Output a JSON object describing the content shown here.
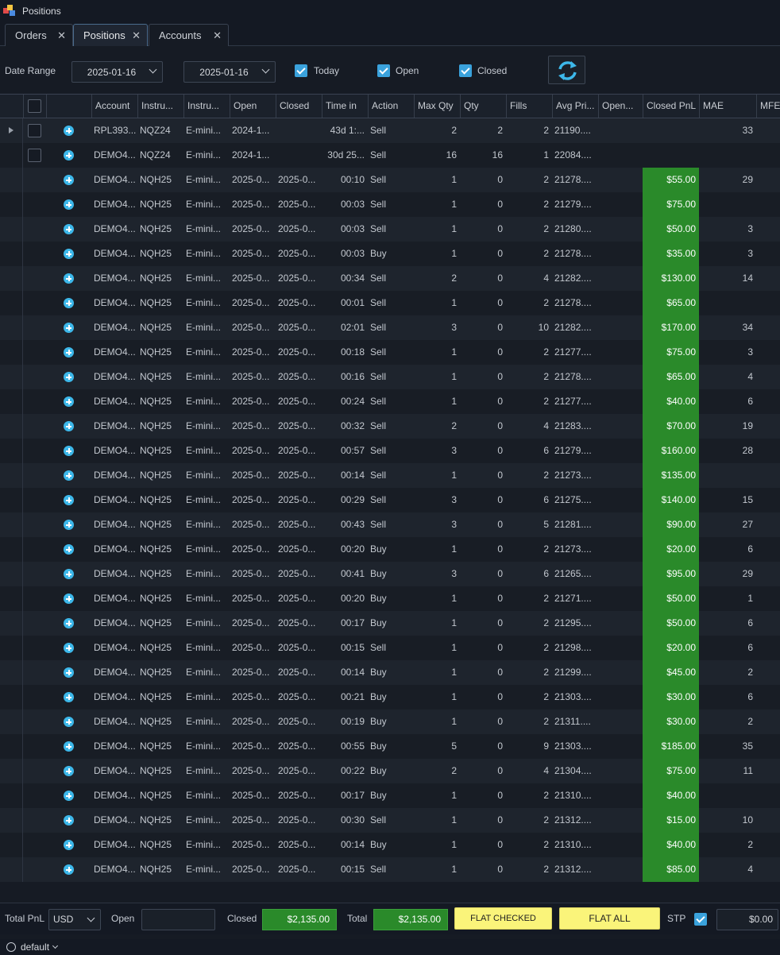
{
  "window": {
    "title": "Positions"
  },
  "tabs": [
    {
      "label": "Orders"
    },
    {
      "label": "Positions"
    },
    {
      "label": "Accounts"
    }
  ],
  "toolbar": {
    "date_range_label": "Date Range",
    "date_from": "2025-01-16",
    "date_to": "2025-01-16",
    "today_label": "Today",
    "open_label": "Open",
    "closed_label": "Closed"
  },
  "columns": [
    "Account",
    "Instru...",
    "Instru...",
    "Open",
    "Closed",
    "Time in",
    "Action",
    "Max Qty",
    "Qty",
    "Fills",
    "Avg Pri...",
    "Open...",
    "Closed PnL",
    "MAE",
    "MFE"
  ],
  "rows": [
    {
      "account": "RPL393...",
      "inst": "NQZ24",
      "desc": "E-mini...",
      "open": "2024-1...",
      "closed": "",
      "time": "43d 1:...",
      "action": "Sell",
      "maxqty": "2",
      "qty": "2",
      "fills": "2",
      "avg": "21190....",
      "openpnl": "",
      "pnl": "",
      "mae": "33",
      "mfe": ""
    },
    {
      "account": "DEMO4...",
      "inst": "NQZ24",
      "desc": "E-mini...",
      "open": "2024-1...",
      "closed": "",
      "time": "30d 25...",
      "action": "Sell",
      "maxqty": "16",
      "qty": "16",
      "fills": "1",
      "avg": "22084....",
      "openpnl": "",
      "pnl": "",
      "mae": "",
      "mfe": ""
    },
    {
      "account": "DEMO4...",
      "inst": "NQH25",
      "desc": "E-mini...",
      "open": "2025-0...",
      "closed": "2025-0...",
      "time": "00:10",
      "action": "Sell",
      "maxqty": "1",
      "qty": "0",
      "fills": "2",
      "avg": "21278....",
      "openpnl": "",
      "pnl": "$55.00",
      "mae": "29",
      "mfe": ""
    },
    {
      "account": "DEMO4...",
      "inst": "NQH25",
      "desc": "E-mini...",
      "open": "2025-0...",
      "closed": "2025-0...",
      "time": "00:03",
      "action": "Sell",
      "maxqty": "1",
      "qty": "0",
      "fills": "2",
      "avg": "21279....",
      "openpnl": "",
      "pnl": "$75.00",
      "mae": "",
      "mfe": ""
    },
    {
      "account": "DEMO4...",
      "inst": "NQH25",
      "desc": "E-mini...",
      "open": "2025-0...",
      "closed": "2025-0...",
      "time": "00:03",
      "action": "Sell",
      "maxqty": "1",
      "qty": "0",
      "fills": "2",
      "avg": "21280....",
      "openpnl": "",
      "pnl": "$50.00",
      "mae": "3",
      "mfe": ""
    },
    {
      "account": "DEMO4...",
      "inst": "NQH25",
      "desc": "E-mini...",
      "open": "2025-0...",
      "closed": "2025-0...",
      "time": "00:03",
      "action": "Buy",
      "maxqty": "1",
      "qty": "0",
      "fills": "2",
      "avg": "21278....",
      "openpnl": "",
      "pnl": "$35.00",
      "mae": "3",
      "mfe": ""
    },
    {
      "account": "DEMO4...",
      "inst": "NQH25",
      "desc": "E-mini...",
      "open": "2025-0...",
      "closed": "2025-0...",
      "time": "00:34",
      "action": "Sell",
      "maxqty": "2",
      "qty": "0",
      "fills": "4",
      "avg": "21282....",
      "openpnl": "",
      "pnl": "$130.00",
      "mae": "14",
      "mfe": ""
    },
    {
      "account": "DEMO4...",
      "inst": "NQH25",
      "desc": "E-mini...",
      "open": "2025-0...",
      "closed": "2025-0...",
      "time": "00:01",
      "action": "Sell",
      "maxqty": "1",
      "qty": "0",
      "fills": "2",
      "avg": "21278....",
      "openpnl": "",
      "pnl": "$65.00",
      "mae": "",
      "mfe": ""
    },
    {
      "account": "DEMO4...",
      "inst": "NQH25",
      "desc": "E-mini...",
      "open": "2025-0...",
      "closed": "2025-0...",
      "time": "02:01",
      "action": "Sell",
      "maxqty": "3",
      "qty": "0",
      "fills": "10",
      "avg": "21282....",
      "openpnl": "",
      "pnl": "$170.00",
      "mae": "34",
      "mfe": ""
    },
    {
      "account": "DEMO4...",
      "inst": "NQH25",
      "desc": "E-mini...",
      "open": "2025-0...",
      "closed": "2025-0...",
      "time": "00:18",
      "action": "Sell",
      "maxqty": "1",
      "qty": "0",
      "fills": "2",
      "avg": "21277....",
      "openpnl": "",
      "pnl": "$75.00",
      "mae": "3",
      "mfe": ""
    },
    {
      "account": "DEMO4...",
      "inst": "NQH25",
      "desc": "E-mini...",
      "open": "2025-0...",
      "closed": "2025-0...",
      "time": "00:16",
      "action": "Sell",
      "maxqty": "1",
      "qty": "0",
      "fills": "2",
      "avg": "21278....",
      "openpnl": "",
      "pnl": "$65.00",
      "mae": "4",
      "mfe": ""
    },
    {
      "account": "DEMO4...",
      "inst": "NQH25",
      "desc": "E-mini...",
      "open": "2025-0...",
      "closed": "2025-0...",
      "time": "00:24",
      "action": "Sell",
      "maxqty": "1",
      "qty": "0",
      "fills": "2",
      "avg": "21277....",
      "openpnl": "",
      "pnl": "$40.00",
      "mae": "6",
      "mfe": ""
    },
    {
      "account": "DEMO4...",
      "inst": "NQH25",
      "desc": "E-mini...",
      "open": "2025-0...",
      "closed": "2025-0...",
      "time": "00:32",
      "action": "Sell",
      "maxqty": "2",
      "qty": "0",
      "fills": "4",
      "avg": "21283....",
      "openpnl": "",
      "pnl": "$70.00",
      "mae": "19",
      "mfe": ""
    },
    {
      "account": "DEMO4...",
      "inst": "NQH25",
      "desc": "E-mini...",
      "open": "2025-0...",
      "closed": "2025-0...",
      "time": "00:57",
      "action": "Sell",
      "maxqty": "3",
      "qty": "0",
      "fills": "6",
      "avg": "21279....",
      "openpnl": "",
      "pnl": "$160.00",
      "mae": "28",
      "mfe": ""
    },
    {
      "account": "DEMO4...",
      "inst": "NQH25",
      "desc": "E-mini...",
      "open": "2025-0...",
      "closed": "2025-0...",
      "time": "00:14",
      "action": "Sell",
      "maxqty": "1",
      "qty": "0",
      "fills": "2",
      "avg": "21273....",
      "openpnl": "",
      "pnl": "$135.00",
      "mae": "",
      "mfe": ""
    },
    {
      "account": "DEMO4...",
      "inst": "NQH25",
      "desc": "E-mini...",
      "open": "2025-0...",
      "closed": "2025-0...",
      "time": "00:29",
      "action": "Sell",
      "maxqty": "3",
      "qty": "0",
      "fills": "6",
      "avg": "21275....",
      "openpnl": "",
      "pnl": "$140.00",
      "mae": "15",
      "mfe": ""
    },
    {
      "account": "DEMO4...",
      "inst": "NQH25",
      "desc": "E-mini...",
      "open": "2025-0...",
      "closed": "2025-0...",
      "time": "00:43",
      "action": "Sell",
      "maxqty": "3",
      "qty": "0",
      "fills": "5",
      "avg": "21281....",
      "openpnl": "",
      "pnl": "$90.00",
      "mae": "27",
      "mfe": ""
    },
    {
      "account": "DEMO4...",
      "inst": "NQH25",
      "desc": "E-mini...",
      "open": "2025-0...",
      "closed": "2025-0...",
      "time": "00:20",
      "action": "Buy",
      "maxqty": "1",
      "qty": "0",
      "fills": "2",
      "avg": "21273....",
      "openpnl": "",
      "pnl": "$20.00",
      "mae": "6",
      "mfe": ""
    },
    {
      "account": "DEMO4...",
      "inst": "NQH25",
      "desc": "E-mini...",
      "open": "2025-0...",
      "closed": "2025-0...",
      "time": "00:41",
      "action": "Buy",
      "maxqty": "3",
      "qty": "0",
      "fills": "6",
      "avg": "21265....",
      "openpnl": "",
      "pnl": "$95.00",
      "mae": "29",
      "mfe": ""
    },
    {
      "account": "DEMO4...",
      "inst": "NQH25",
      "desc": "E-mini...",
      "open": "2025-0...",
      "closed": "2025-0...",
      "time": "00:20",
      "action": "Buy",
      "maxqty": "1",
      "qty": "0",
      "fills": "2",
      "avg": "21271....",
      "openpnl": "",
      "pnl": "$50.00",
      "mae": "1",
      "mfe": ""
    },
    {
      "account": "DEMO4...",
      "inst": "NQH25",
      "desc": "E-mini...",
      "open": "2025-0...",
      "closed": "2025-0...",
      "time": "00:17",
      "action": "Buy",
      "maxqty": "1",
      "qty": "0",
      "fills": "2",
      "avg": "21295....",
      "openpnl": "",
      "pnl": "$50.00",
      "mae": "6",
      "mfe": ""
    },
    {
      "account": "DEMO4...",
      "inst": "NQH25",
      "desc": "E-mini...",
      "open": "2025-0...",
      "closed": "2025-0...",
      "time": "00:15",
      "action": "Sell",
      "maxqty": "1",
      "qty": "0",
      "fills": "2",
      "avg": "21298....",
      "openpnl": "",
      "pnl": "$20.00",
      "mae": "6",
      "mfe": ""
    },
    {
      "account": "DEMO4...",
      "inst": "NQH25",
      "desc": "E-mini...",
      "open": "2025-0...",
      "closed": "2025-0...",
      "time": "00:14",
      "action": "Buy",
      "maxqty": "1",
      "qty": "0",
      "fills": "2",
      "avg": "21299....",
      "openpnl": "",
      "pnl": "$45.00",
      "mae": "2",
      "mfe": ""
    },
    {
      "account": "DEMO4...",
      "inst": "NQH25",
      "desc": "E-mini...",
      "open": "2025-0...",
      "closed": "2025-0...",
      "time": "00:21",
      "action": "Buy",
      "maxqty": "1",
      "qty": "0",
      "fills": "2",
      "avg": "21303....",
      "openpnl": "",
      "pnl": "$30.00",
      "mae": "6",
      "mfe": ""
    },
    {
      "account": "DEMO4...",
      "inst": "NQH25",
      "desc": "E-mini...",
      "open": "2025-0...",
      "closed": "2025-0...",
      "time": "00:19",
      "action": "Buy",
      "maxqty": "1",
      "qty": "0",
      "fills": "2",
      "avg": "21311....",
      "openpnl": "",
      "pnl": "$30.00",
      "mae": "2",
      "mfe": ""
    },
    {
      "account": "DEMO4...",
      "inst": "NQH25",
      "desc": "E-mini...",
      "open": "2025-0...",
      "closed": "2025-0...",
      "time": "00:55",
      "action": "Buy",
      "maxqty": "5",
      "qty": "0",
      "fills": "9",
      "avg": "21303....",
      "openpnl": "",
      "pnl": "$185.00",
      "mae": "35",
      "mfe": ""
    },
    {
      "account": "DEMO4...",
      "inst": "NQH25",
      "desc": "E-mini...",
      "open": "2025-0...",
      "closed": "2025-0...",
      "time": "00:22",
      "action": "Buy",
      "maxqty": "2",
      "qty": "0",
      "fills": "4",
      "avg": "21304....",
      "openpnl": "",
      "pnl": "$75.00",
      "mae": "11",
      "mfe": ""
    },
    {
      "account": "DEMO4...",
      "inst": "NQH25",
      "desc": "E-mini...",
      "open": "2025-0...",
      "closed": "2025-0...",
      "time": "00:17",
      "action": "Buy",
      "maxqty": "1",
      "qty": "0",
      "fills": "2",
      "avg": "21310....",
      "openpnl": "",
      "pnl": "$40.00",
      "mae": "",
      "mfe": ""
    },
    {
      "account": "DEMO4...",
      "inst": "NQH25",
      "desc": "E-mini...",
      "open": "2025-0...",
      "closed": "2025-0...",
      "time": "00:30",
      "action": "Sell",
      "maxqty": "1",
      "qty": "0",
      "fills": "2",
      "avg": "21312....",
      "openpnl": "",
      "pnl": "$15.00",
      "mae": "10",
      "mfe": ""
    },
    {
      "account": "DEMO4...",
      "inst": "NQH25",
      "desc": "E-mini...",
      "open": "2025-0...",
      "closed": "2025-0...",
      "time": "00:14",
      "action": "Buy",
      "maxqty": "1",
      "qty": "0",
      "fills": "2",
      "avg": "21310....",
      "openpnl": "",
      "pnl": "$40.00",
      "mae": "2",
      "mfe": ""
    },
    {
      "account": "DEMO4...",
      "inst": "NQH25",
      "desc": "E-mini...",
      "open": "2025-0...",
      "closed": "2025-0...",
      "time": "00:15",
      "action": "Sell",
      "maxqty": "1",
      "qty": "0",
      "fills": "2",
      "avg": "21312....",
      "openpnl": "",
      "pnl": "$85.00",
      "mae": "4",
      "mfe": ""
    }
  ],
  "footer": {
    "total_pnl_label": "Total PnL",
    "currency": "USD",
    "open_label": "Open",
    "open_value": "",
    "closed_label": "Closed",
    "closed_value": "$2,135.00",
    "total_label": "Total",
    "total_value": "$2,135.00",
    "flat_checked_label": "FLAT CHECKED",
    "flat_all_label": "FLAT ALL",
    "stp_label": "STP",
    "stp_value": "$0.00"
  },
  "status": {
    "profile": "default"
  },
  "colors": {
    "pnl_positive": "#2a8a2a",
    "accent": "#3aa2dc",
    "flat_button": "#faf47a"
  }
}
